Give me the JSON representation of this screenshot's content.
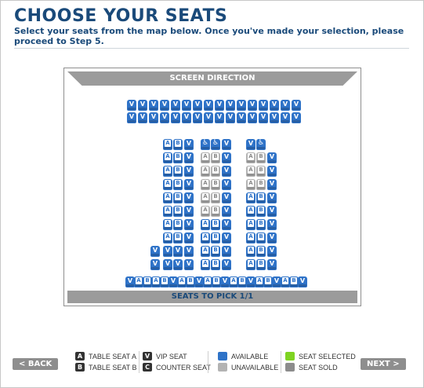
{
  "header": {
    "title": "CHOOSE YOUR SEATS",
    "subtitle": "Select your seats from the map below. Once you've made your selection, please proceed to Step 5."
  },
  "seat_map": {
    "screen_label": "SCREEN DIRECTION",
    "seats_to_pick_label": "SEATS TO PICK 1/1"
  },
  "legend": {
    "table_a": {
      "badge": "A",
      "label": "TABLE SEAT A"
    },
    "table_b": {
      "badge": "B",
      "label": "TABLE SEAT B"
    },
    "vip": {
      "badge": "V",
      "label": "VIP SEAT"
    },
    "counter": {
      "badge": "C",
      "label": "COUNTER SEAT"
    },
    "available": {
      "label": "AVAILABLE",
      "color": "#2f73c8"
    },
    "unavailable": {
      "label": "UNAVAILABLE",
      "color": "#b3b3b3"
    },
    "selected": {
      "label": "SEAT SELECTED",
      "color": "#7ed321"
    },
    "sold": {
      "label": "SEAT SOLD",
      "color": "#8c8c8c"
    }
  },
  "nav": {
    "back_label": "< BACK",
    "next_label": "NEXT >"
  },
  "colors": {
    "accent": "#1a4a7a",
    "seat_available": "#2f73c8",
    "seat_unavailable": "#b3b3b3"
  }
}
